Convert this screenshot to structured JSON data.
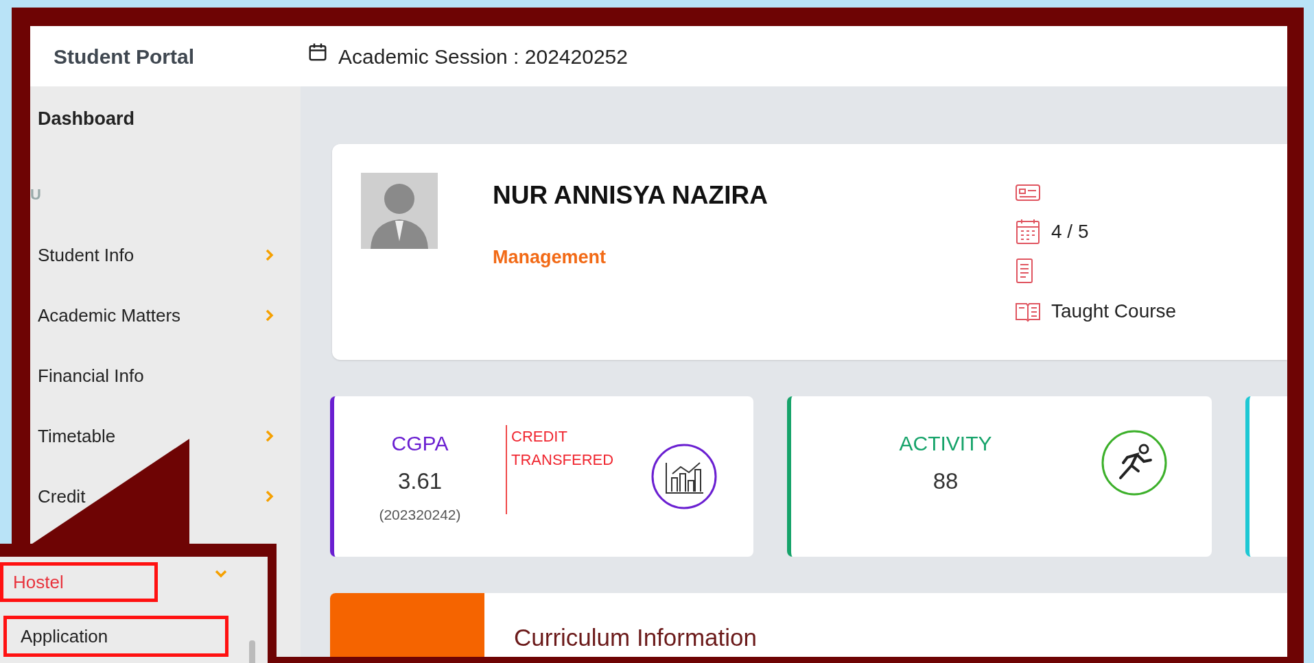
{
  "header": {
    "title": "Student Portal",
    "session": "Academic Session : 202420252"
  },
  "sidebar": {
    "heading": "Dashboard",
    "section_label": "U",
    "items": [
      {
        "label": "Student Info",
        "has_submenu": true
      },
      {
        "label": "Academic Matters",
        "has_submenu": true
      },
      {
        "label": "Financial Info",
        "has_submenu": false
      },
      {
        "label": "Timetable",
        "has_submenu": true
      },
      {
        "label": "Credit",
        "has_submenu": true
      }
    ]
  },
  "profile": {
    "name": "NUR ANNISYA NAZIRA",
    "programme": "Management",
    "details": [
      {
        "kind": "id-card"
      },
      {
        "kind": "calendar",
        "text": "4 / 5"
      },
      {
        "kind": "notebook"
      },
      {
        "kind": "book",
        "text": "Taught Course"
      }
    ]
  },
  "stats": [
    {
      "kind": "cgpa",
      "title": "CGPA",
      "value": "3.61",
      "note": "(202320242)",
      "extra": "CREDIT TRANSFERED",
      "color": "#6a1fd1"
    },
    {
      "kind": "activity",
      "title": "ACTIVITY",
      "value": "88",
      "color": "#16a36a"
    },
    {
      "kind": "partial",
      "color": "#1ec8d4"
    }
  ],
  "curriculum": {
    "title": "Curriculum Information"
  },
  "callout": {
    "menu": {
      "label": "Hostel",
      "expanded": true
    },
    "submenu": [
      {
        "label": "Application"
      }
    ]
  }
}
